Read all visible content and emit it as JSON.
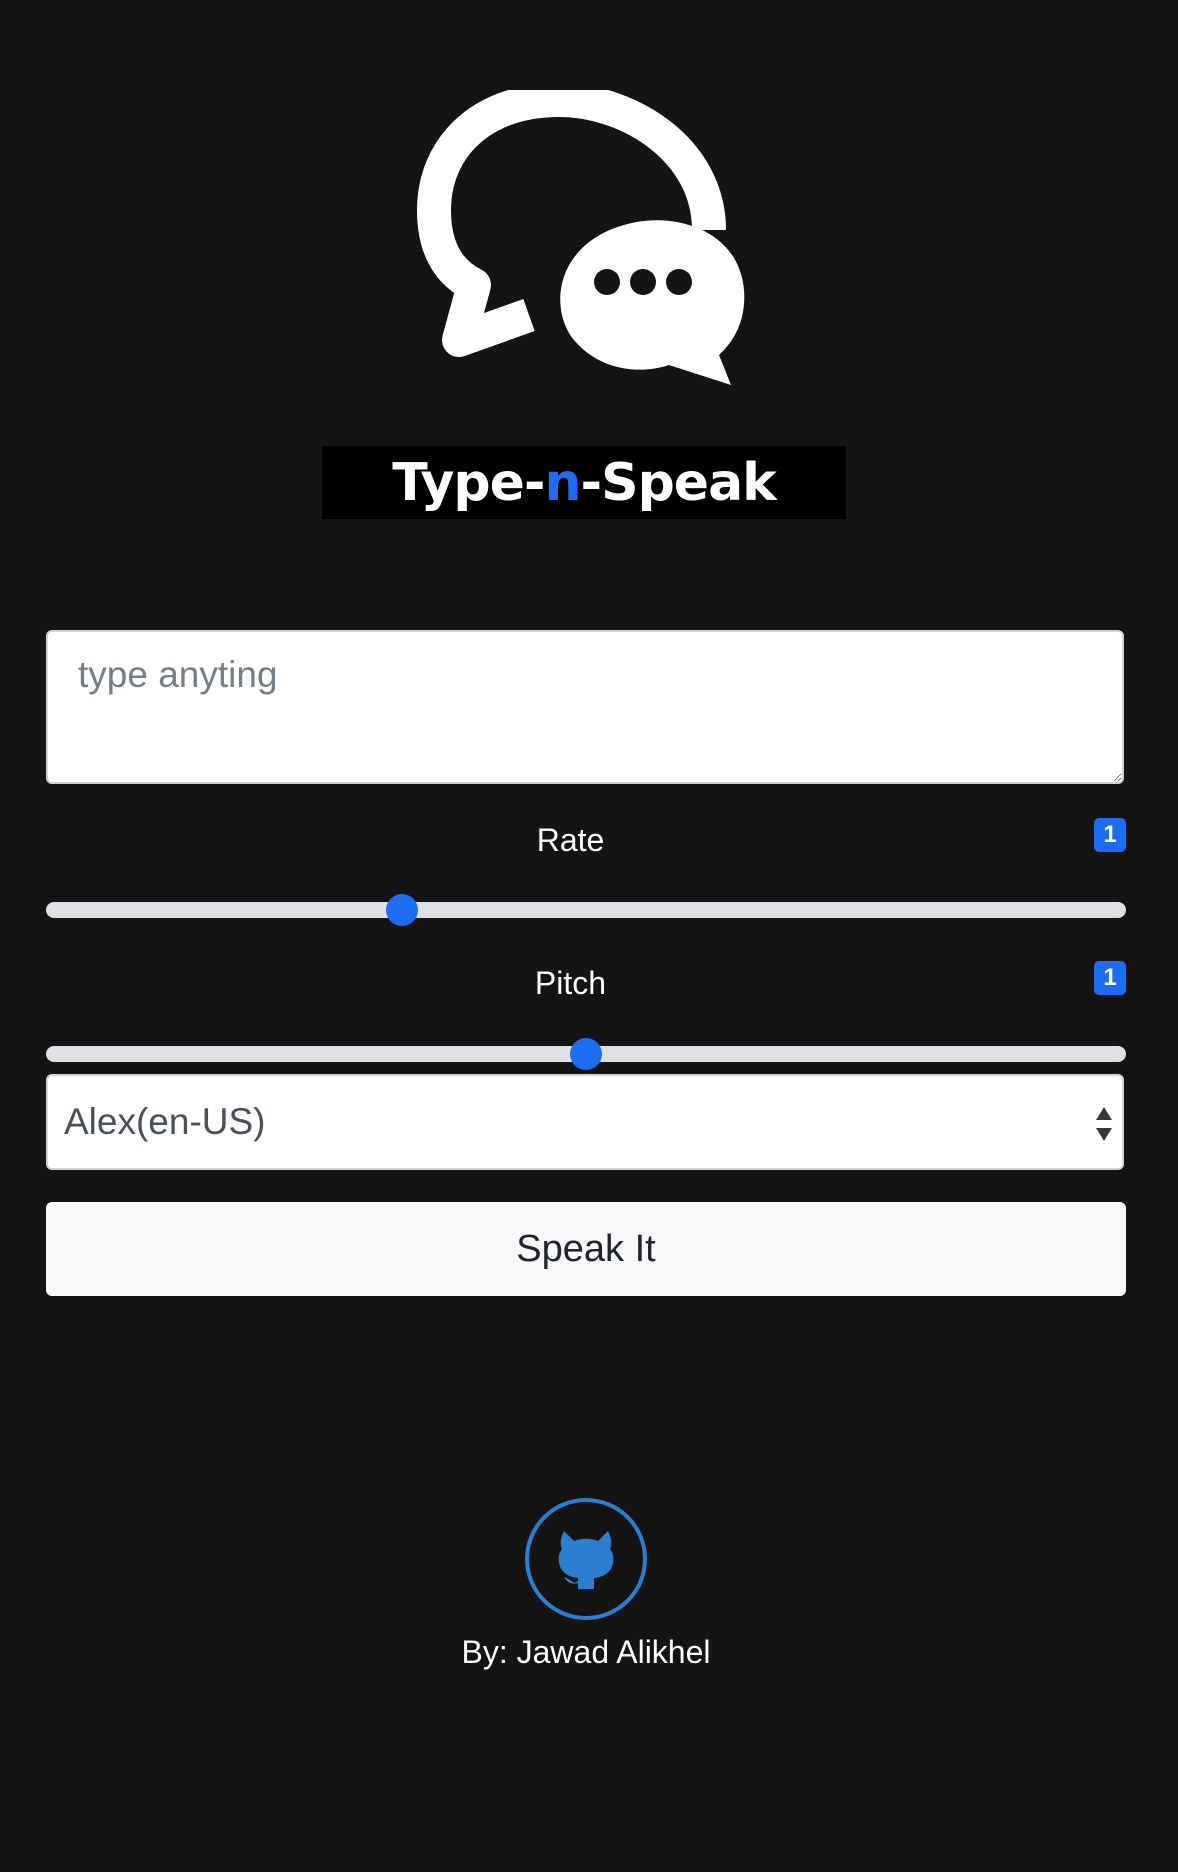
{
  "logo": {
    "title_part1": "Type-",
    "title_accent": "n",
    "title_part2": "-Speak",
    "icon": "speech-bubbles-icon"
  },
  "input": {
    "placeholder": "type anyting",
    "value": ""
  },
  "rate": {
    "label": "Rate",
    "badge": "1",
    "fraction": 0.33
  },
  "pitch": {
    "label": "Pitch",
    "badge": "1",
    "fraction": 0.5
  },
  "voice_select": {
    "selected": "Alex(en-US)"
  },
  "speak_button": {
    "label": "Speak It"
  },
  "footer": {
    "github_icon": "github-icon",
    "author": "By: Jawad Alikhel"
  },
  "colors": {
    "background": "#141414",
    "accent": "#1e6cf0",
    "github_ring": "#2c7fcf"
  }
}
